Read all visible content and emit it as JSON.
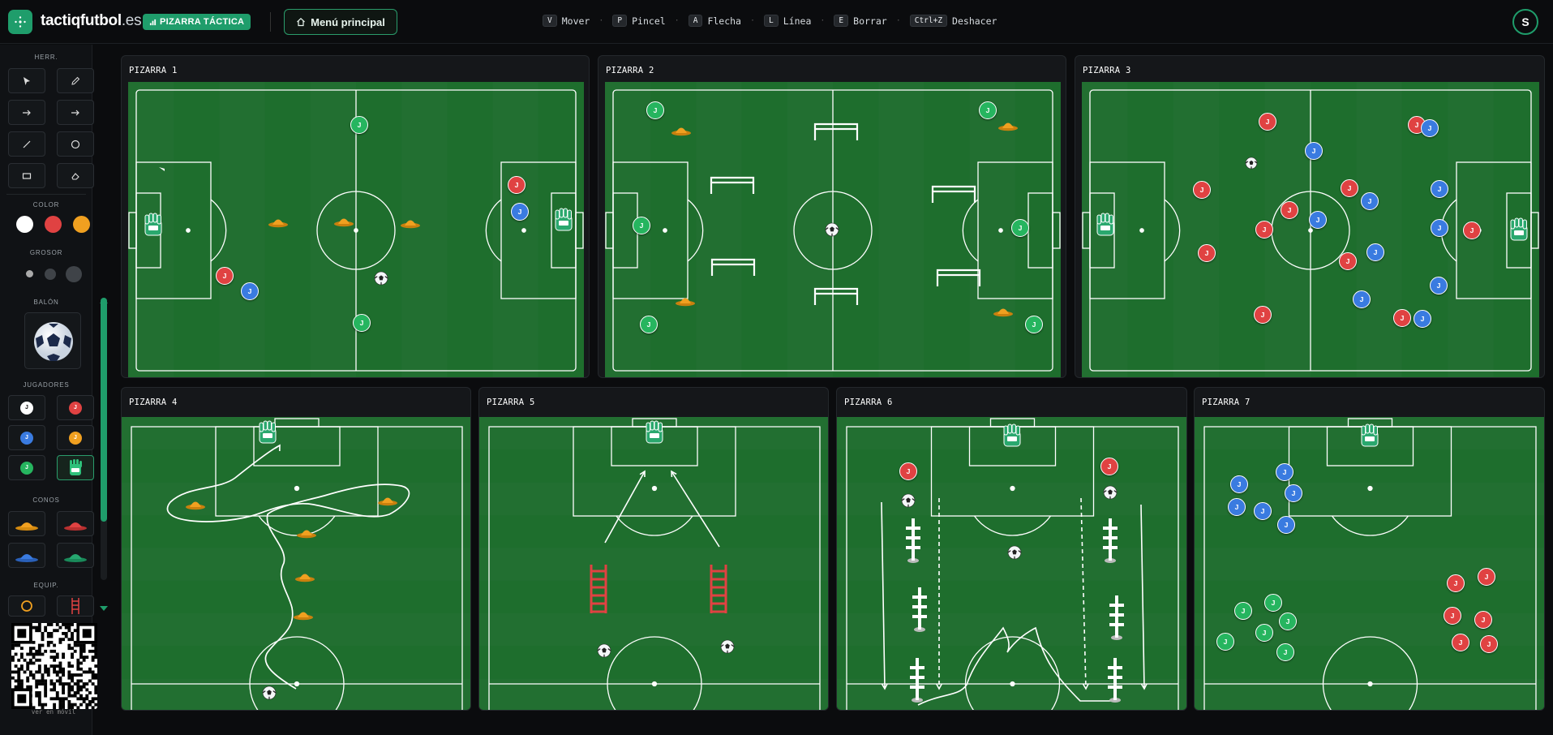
{
  "app": {
    "brand_main": "tactiqfutbol",
    "brand_tld": ".es",
    "badge": "PIZARRA TÁCTICA",
    "menu_button": "Menú principal",
    "avatar": "S"
  },
  "shortcuts": [
    {
      "key": "V",
      "label": "Mover"
    },
    {
      "key": "P",
      "label": "Pincel"
    },
    {
      "key": "A",
      "label": "Flecha"
    },
    {
      "key": "L",
      "label": "Línea"
    },
    {
      "key": "E",
      "label": "Borrar"
    },
    {
      "key": "Ctrl+Z",
      "label": "Deshacer"
    }
  ],
  "sidebar": {
    "herr": "HERR.",
    "color": "COLOR",
    "grosor": "GROSOR",
    "balon": "BALÓN",
    "jugadores": "JUGADORES",
    "conos": "CONOS",
    "equip": "EQUIP.",
    "colors": [
      "#ffffff",
      "#e04242",
      "#f0a020"
    ],
    "player_colors": [
      "#ffffff",
      "#e04242",
      "#3a7be0",
      "#f0a020",
      "#26b55f"
    ],
    "player_label": "J",
    "qr_caption": "ver en móvil"
  },
  "boards": [
    "PIZARRA 1",
    "PIZARRA 2",
    "PIZARRA 3",
    "PIZARRA 4",
    "PIZARRA 5",
    "PIZARRA 6",
    "PIZARRA 7"
  ],
  "colors": {
    "accent": "#1f9d6b",
    "pitch": "#1e6e2d",
    "red": "#e04242",
    "blue": "#3a7be0",
    "green": "#26b55f",
    "cone": "#f0a020"
  }
}
